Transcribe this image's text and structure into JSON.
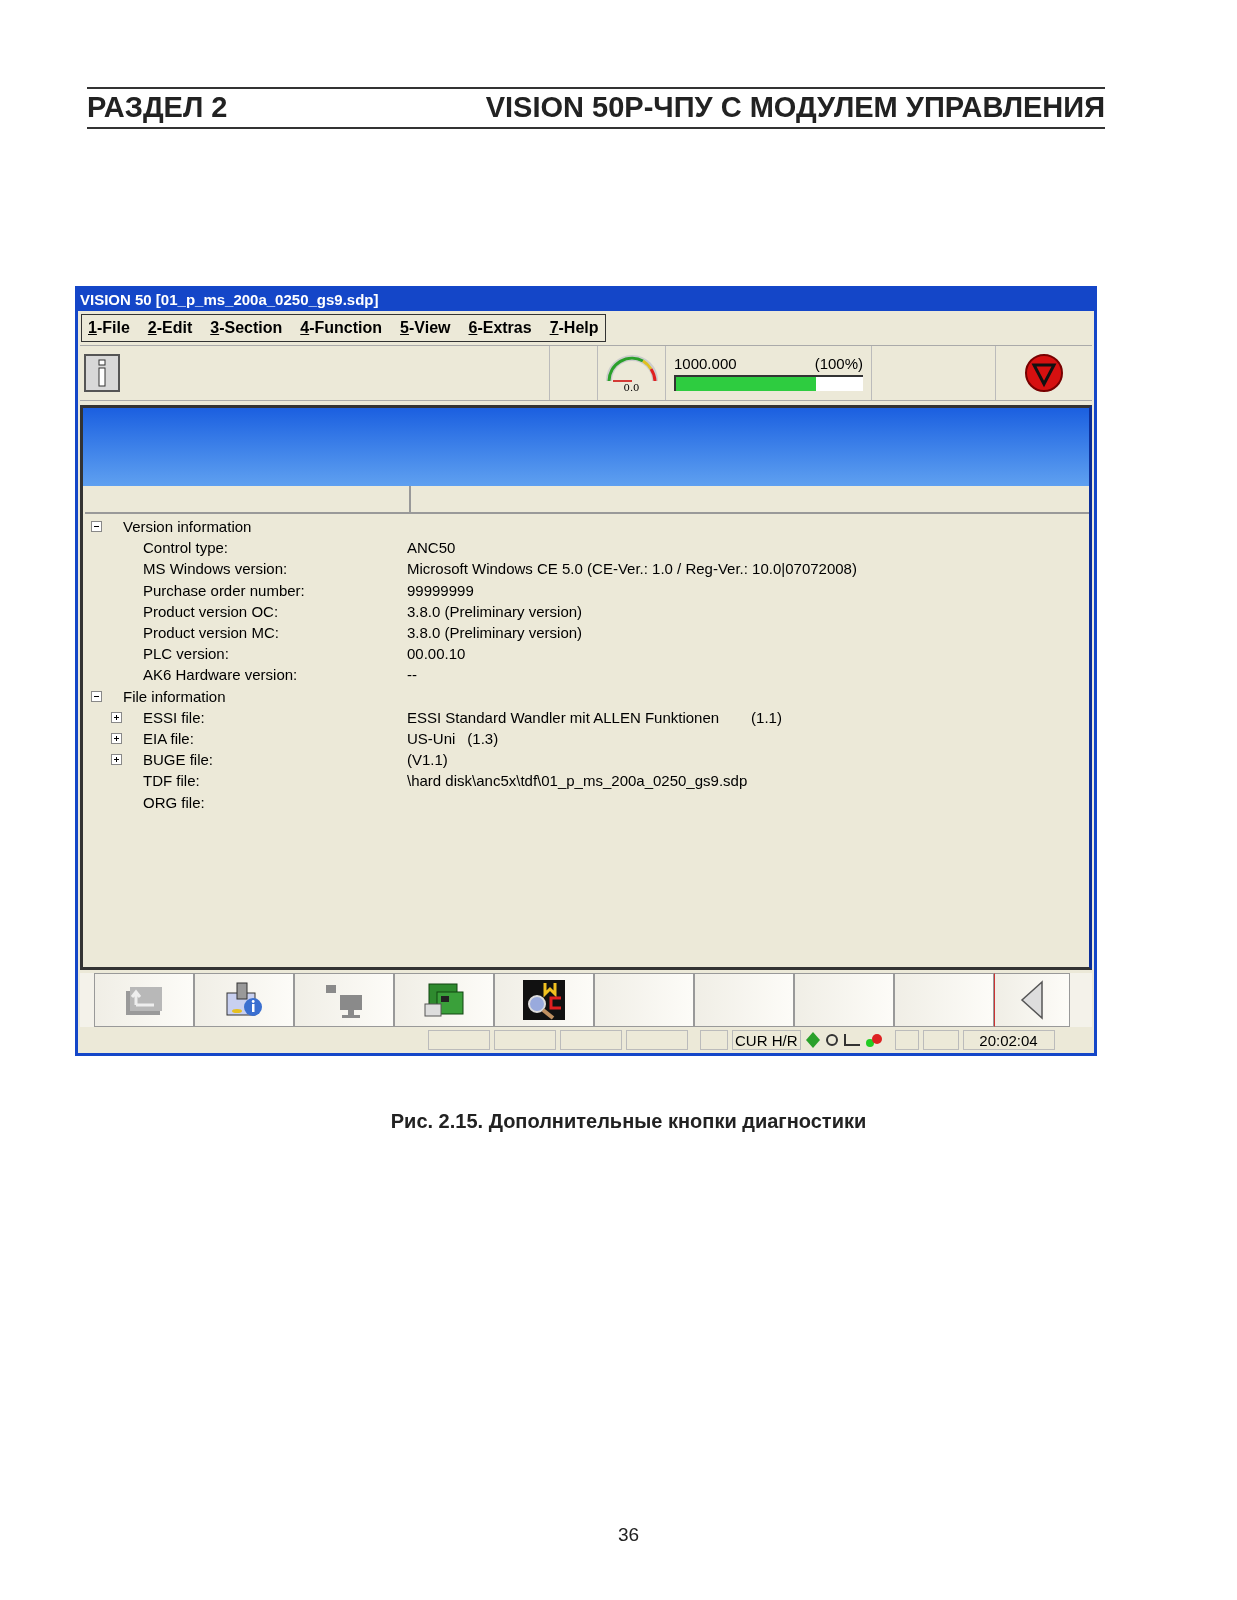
{
  "page_header": {
    "section": "РАЗДЕЛ 2",
    "title": "VISION 50P-ЧПУ С МОДУЛЕМ УПРАВЛЕНИЯ"
  },
  "window": {
    "title": "VISION 50 [01_p_ms_200a_0250_gs9.sdp]"
  },
  "menu": [
    {
      "mnemonic": "1",
      "label": "-File"
    },
    {
      "mnemonic": "2",
      "label": "-Edit"
    },
    {
      "mnemonic": "3",
      "label": "-Section"
    },
    {
      "mnemonic": "4",
      "label": "-Function"
    },
    {
      "mnemonic": "5",
      "label": "-View"
    },
    {
      "mnemonic": "6",
      "label": "-Extras"
    },
    {
      "mnemonic": "7",
      "label": "-Help"
    }
  ],
  "toolbar": {
    "gauge_reading": "0.0",
    "feed": "1000.000",
    "percent": "(100%)",
    "level": 0.75
  },
  "tree": [
    {
      "label": "Version information",
      "expanded": true,
      "children": [
        {
          "label": "Control type:",
          "value": "ANC50"
        },
        {
          "label": "MS Windows version:",
          "value": "Microsoft Windows CE 5.0 (CE-Ver.: 1.0 / Reg-Ver.: 10.0|07072008)"
        },
        {
          "label": "Purchase order number:",
          "value": "99999999"
        },
        {
          "label": "Product version OC:",
          "value": "3.8.0 (Preliminary version)"
        },
        {
          "label": "Product version MC:",
          "value": "3.8.0 (Preliminary version)"
        },
        {
          "label": "PLC version:",
          "value": "00.00.10"
        },
        {
          "label": "AK6 Hardware version:",
          "value": "--"
        }
      ]
    },
    {
      "label": "File information",
      "expanded": true,
      "children": [
        {
          "label": "ESSI file:",
          "value": "ESSI Standard Wandler mit ALLEN Funktionen",
          "extra": "(1.1)",
          "expanded": false
        },
        {
          "label": "EIA file:",
          "value": "US-Uni",
          "extra": "(1.3)",
          "expanded": false
        },
        {
          "label": "BUGE file:",
          "value": "(V1.1)",
          "expanded": false
        },
        {
          "label": "TDF file:",
          "value": "\\hard disk\\anc5x\\tdf\\01_p_ms_200a_0250_gs9.sdp"
        },
        {
          "label": "ORG file:"
        }
      ]
    }
  ],
  "softkeys": [
    {
      "kind": "up"
    },
    {
      "kind": "info"
    },
    {
      "kind": "plug"
    },
    {
      "kind": "card"
    },
    {
      "kind": "mc"
    },
    {
      "kind": "blank"
    },
    {
      "kind": "blank"
    },
    {
      "kind": "blank"
    },
    {
      "kind": "blank"
    },
    {
      "kind": "back"
    }
  ],
  "status_bar": {
    "mode": "CUR H/R",
    "time": "20:02:04"
  },
  "caption": "Рис. 2.15. Дополнительные кнопки диагностики",
  "page_number": "36"
}
